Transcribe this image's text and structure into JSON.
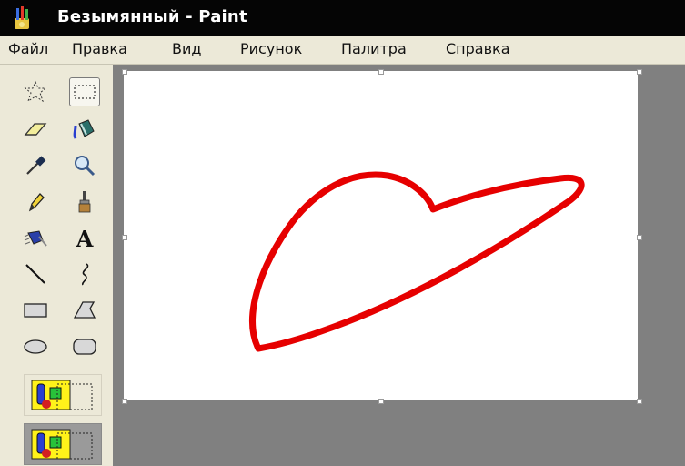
{
  "window": {
    "title": "Безымянный - Paint",
    "title_bg": "#050505",
    "menu_bg": "#ece9d8",
    "workspace_bg": "#808080",
    "canvas_bg": "#ffffff"
  },
  "menu": {
    "items": [
      "Файл",
      "Правка",
      "Вид",
      "Рисунок",
      "Палитра",
      "Справка"
    ]
  },
  "toolbox": {
    "tools": [
      {
        "name": "free-form-select-icon"
      },
      {
        "name": "rect-select-icon",
        "selected": true
      },
      {
        "name": "eraser-icon"
      },
      {
        "name": "fill-bucket-icon"
      },
      {
        "name": "color-picker-icon"
      },
      {
        "name": "magnifier-icon"
      },
      {
        "name": "pencil-icon"
      },
      {
        "name": "brush-icon"
      },
      {
        "name": "airbrush-icon"
      },
      {
        "name": "text-icon",
        "glyph": "A"
      },
      {
        "name": "line-icon"
      },
      {
        "name": "curve-icon"
      },
      {
        "name": "rectangle-icon"
      },
      {
        "name": "polygon-icon"
      },
      {
        "name": "ellipse-icon"
      },
      {
        "name": "rounded-rectangle-icon"
      }
    ],
    "selection_modes": [
      {
        "name": "opaque-selection-icon"
      },
      {
        "name": "transparent-selection-icon",
        "selected": true
      }
    ]
  },
  "drawing": {
    "stroke_color": "#e60000",
    "shape": "freehand-heart-outline"
  }
}
